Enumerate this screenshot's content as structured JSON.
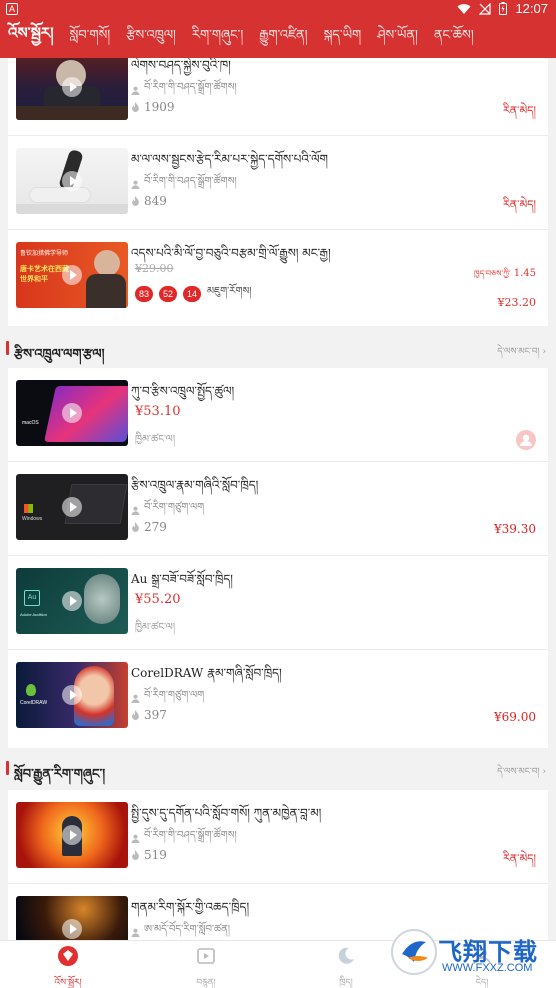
{
  "status_bar": {
    "app_badge": "A",
    "time": "12:07"
  },
  "top_nav": {
    "tabs": [
      "འོས་སྦྱོར།",
      "སློབ་གསོ།",
      "རྩིས་འཁྲུལ།",
      "རིག་གཞུང་།",
      "རྒྱུག་འཛིན།",
      "སྐད་ཡིག",
      "ཤེས་ཡོན།",
      "ནང་ཆོས།"
    ]
  },
  "top_items": [
    {
      "title": "ལེགས་བཤད་སྐྱེས་བུའི་ཁ།",
      "author": "བོ་རིག་གི་བཤད་སྒྲོག་ཚོགས།",
      "views": "1909",
      "tag": "རིན་མེད།",
      "thumb": "lecture"
    },
    {
      "title": "མ་ལ་ལས་སྦྱངས་རྩེད་རིམ་པར་སྐྱེད་དགོས་པའི་ལོག",
      "author": "བོ་རིག་གི་བཤད་སྒྲོག་ཚོགས།",
      "views": "849",
      "tag": "རིན་མེད།",
      "thumb": "yoga"
    }
  ],
  "flash_item": {
    "title": "འདས་པའི་མི་ལོ་བྱ་བཅུའི་བརྩམ་གྲི་ལོ་རྒྱུས། མང་རྒྱ།",
    "old_price": "¥29.00",
    "sale_label": "ཁྱད་བཅས་ཀྱི་",
    "sale_price": "1.45",
    "countdown": [
      "83",
      "52",
      "14"
    ],
    "countdown_label": "མཇུག་རོགས།",
    "price": "¥23.20",
    "banner_lines": [
      "鲁钦加措佛学导师",
      "唐卡艺术在西藏",
      "世界和平"
    ]
  },
  "section1": {
    "label": "རྩིས་འཁྲུལ་ལག་རྩལ།",
    "more": "དེ་ལས་མང་བ།"
  },
  "section1_items": [
    {
      "title": "ཀུ་བ་རྩིས་འཁྲུལ་སྤྱོད་ཚུལ།",
      "price": "¥53.10",
      "soft": "ཁྱིམ་ཚང་ལ།",
      "thumb": "mac",
      "thumb_label": "macOS"
    },
    {
      "title": "རྩིས་འཁྲུལ་རྣམ་གཞིའི་སློབ་ཁྲིད།",
      "author": "བོ་རིག་གཙུག་ལག",
      "views": "279",
      "right_price": "¥39.30",
      "thumb": "windows",
      "thumb_label": "Windows"
    },
    {
      "title": "Au སྒྲ་བཟོ་བཟོ་སློབ་ཁྲིད།",
      "price": "¥55.20",
      "soft": "ཁྱིམ་ཚང་ལ།",
      "thumb": "audition",
      "thumb_label": "Adobe Audition"
    },
    {
      "title": "CorelDRAW རྣམ་གཞི་སློབ་ཁྲིད།",
      "author": "བོ་རིག་གཙུག་ལག",
      "views": "397",
      "right_price": "¥69.00",
      "thumb": "corel",
      "thumb_label": "CorelDRAW"
    }
  ],
  "section2": {
    "label": "སློབ་རྒྱུན་རིག་གཞུང་།",
    "more": "དེ་ལས་མང་བ།"
  },
  "section2_items": [
    {
      "title": "སྤྱི་དུས་དུ་དགོན་པའི་སློབ་གསོ། ཀུན་མཁྱེན་བླ་མ།",
      "author": "བོ་རིག་གི་བཤད་སྒྲོག་ཚོགས།",
      "views": "519",
      "tag": "རིན་མེད།",
      "thumb": "fire"
    },
    {
      "title": "གནམ་རིག་སྐོར་གྱི་འཆད་ཁྲིད།",
      "author": "ཨ་མདོ་བོད་རིག་སློབ་ཚན།",
      "views": "",
      "thumb": "space"
    }
  ],
  "bottom_nav": [
    {
      "label": "འོས་སྦྱོར།",
      "active": true
    },
    {
      "label": "བརྙན།",
      "active": false
    },
    {
      "label": "ཁྲིད།",
      "active": false
    },
    {
      "label": "ངེད།",
      "active": false
    }
  ],
  "watermark": {
    "text": "飞翔下载",
    "url": "WWW.FXXZ.COM"
  },
  "colors": {
    "brand_red": "#d73232",
    "price_red": "#e03030"
  }
}
